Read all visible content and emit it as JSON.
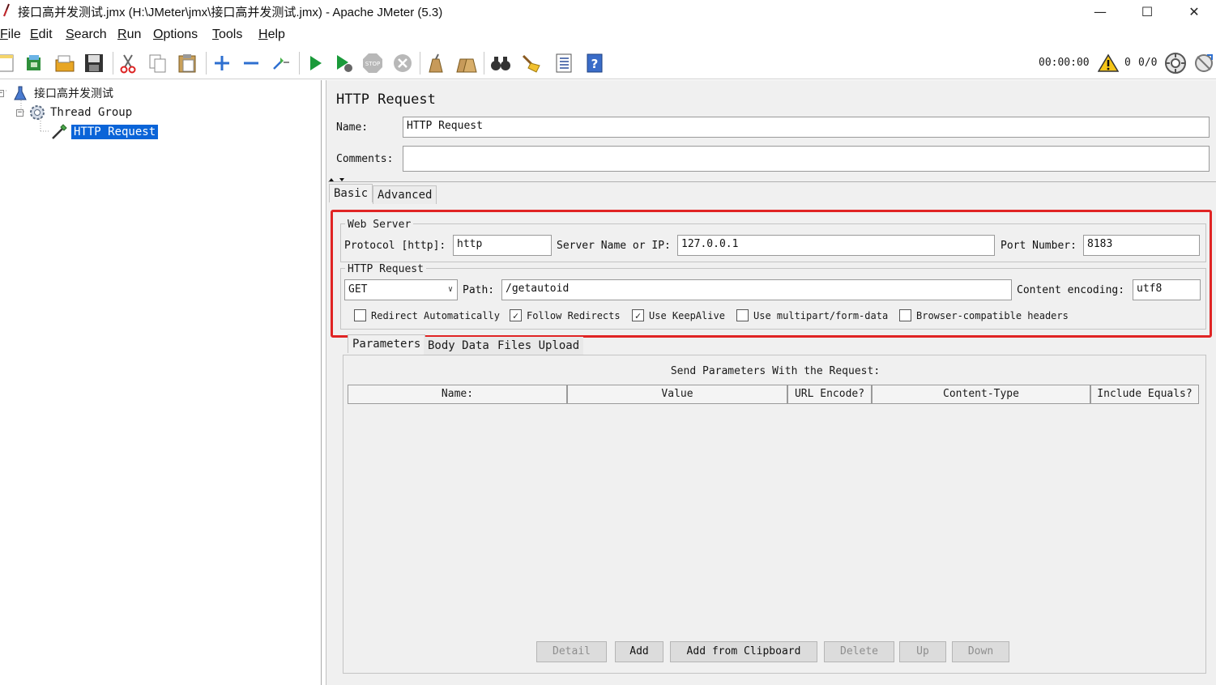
{
  "window": {
    "title": "接口高并发测试.jmx (H:\\JMeter\\jmx\\接口高并发测试.jmx) - Apache JMeter (5.3)",
    "minimize_glyph": "—",
    "maximize_glyph": "☐",
    "close_glyph": "✕"
  },
  "menu": {
    "file": {
      "first": "F",
      "rest": "ile"
    },
    "edit": {
      "first": "E",
      "rest": "dit"
    },
    "search": {
      "first": "S",
      "rest": "earch"
    },
    "run": {
      "first": "R",
      "rest": "un"
    },
    "options": {
      "first": "O",
      "rest": "ptions"
    },
    "tools": {
      "first": "T",
      "rest": "ools"
    },
    "help": {
      "first": "H",
      "rest": "elp"
    }
  },
  "toolbar": {
    "icons": [
      "new-icon",
      "templates-icon",
      "open-icon",
      "save-icon",
      "cut-icon",
      "copy-icon",
      "paste-icon",
      "expand-icon",
      "collapse-icon",
      "toggle-icon",
      "start-icon",
      "start-no-pause-icon",
      "stop-icon",
      "shutdown-icon",
      "clear-icon",
      "clear-all-icon",
      "search-icon",
      "reset-search-icon",
      "function-helper-icon",
      "help-icon"
    ],
    "timer": "00:00:00",
    "warnings": "0",
    "threads": "0/0"
  },
  "tree": {
    "root": "接口高并发测试",
    "thread_group": "Thread Group",
    "http_request": "HTTP Request"
  },
  "editor": {
    "title": "HTTP Request",
    "name_label": "Name:",
    "name_value": "HTTP Request",
    "comments_label": "Comments:",
    "comments_value": "",
    "tabs": {
      "basic": "Basic",
      "advanced": "Advanced"
    },
    "web_server": {
      "group_title": "Web Server",
      "protocol_label": "Protocol [http]:",
      "protocol_value": "http",
      "server_label": "Server Name or IP:",
      "server_value": "127.0.0.1",
      "port_label": "Port Number:",
      "port_value": "8183"
    },
    "http_request": {
      "group_title": "HTTP Request",
      "method": "GET",
      "path_label": "Path:",
      "path_value": "/getautoid",
      "encoding_label": "Content encoding:",
      "encoding_value": "utf8"
    },
    "options": {
      "redirect_auto": {
        "label": "Redirect Automatically",
        "checked": false
      },
      "follow_redirects": {
        "label": "Follow Redirects",
        "checked": true
      },
      "keepalive": {
        "label": "Use KeepAlive",
        "checked": true
      },
      "multipart": {
        "label": "Use multipart/form-data",
        "checked": false
      },
      "browser_headers": {
        "label": "Browser-compatible headers",
        "checked": false
      }
    },
    "sub_tabs": {
      "parameters": "Parameters",
      "body_data": "Body Data",
      "files_upload": "Files Upload"
    },
    "params": {
      "caption": "Send Parameters With the Request:",
      "columns": [
        "Name:",
        "Value",
        "URL Encode?",
        "Content-Type",
        "Include Equals?"
      ],
      "rows": []
    },
    "buttons": {
      "detail": "Detail",
      "add": "Add",
      "add_clipboard": "Add from Clipboard",
      "delete": "Delete",
      "up": "Up",
      "down": "Down"
    }
  },
  "colors": {
    "selection": "#0a64d8",
    "highlight_box": "#e02424",
    "panel_bg": "#f0f0f0"
  }
}
